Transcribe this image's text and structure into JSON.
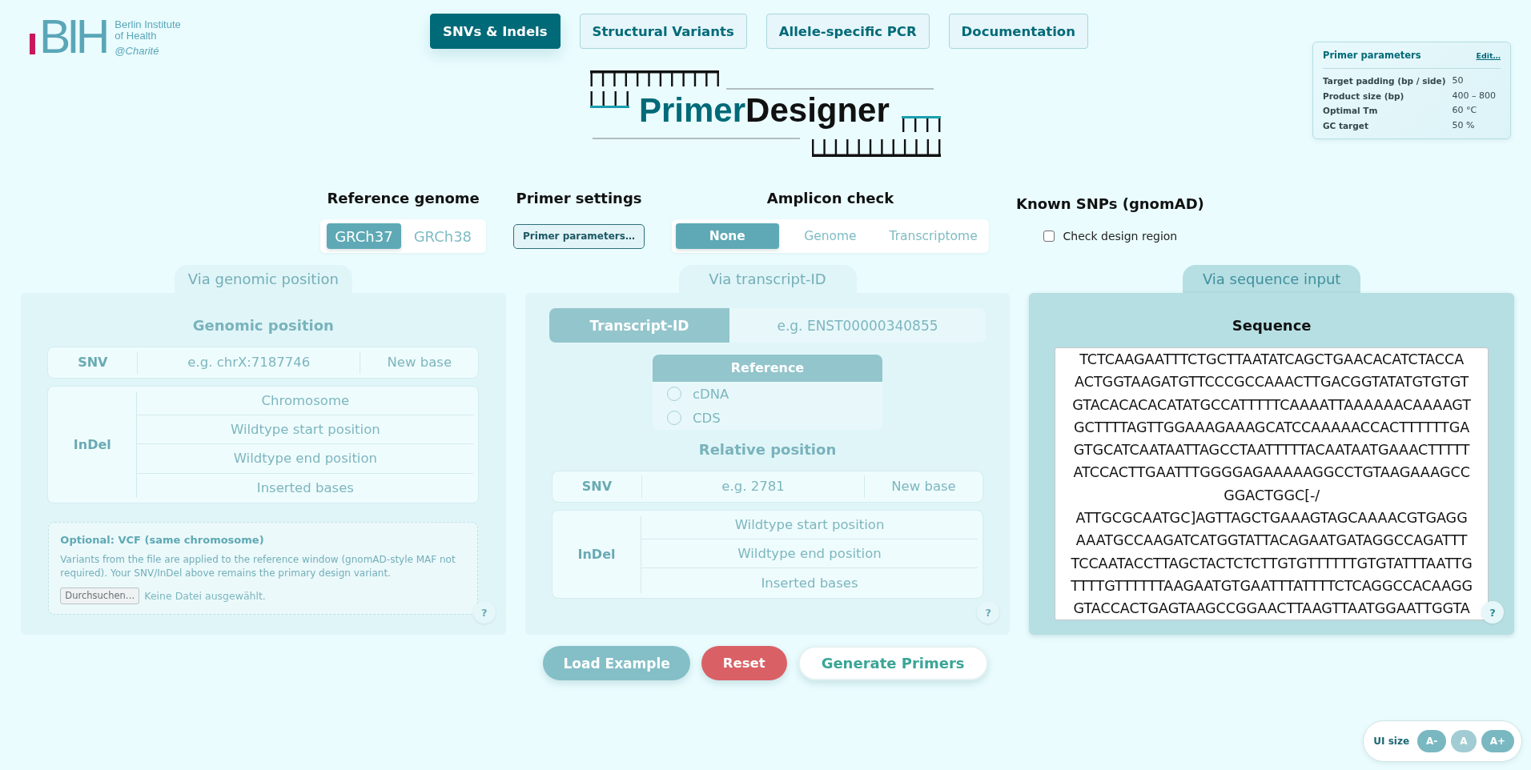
{
  "logo": {
    "mark": "BIH",
    "name_lines": [
      "Berlin Institute",
      "of Health"
    ],
    "affiliation": "@Charité"
  },
  "nav_tabs": [
    {
      "label": "SNVs & Indels",
      "selected": true
    },
    {
      "label": "Structural Variants",
      "selected": false
    },
    {
      "label": "Allele-specific PCR",
      "selected": false
    },
    {
      "label": "Documentation",
      "selected": false
    }
  ],
  "app_title": {
    "parts": [
      "Primer",
      "Designer"
    ]
  },
  "parameters_card": {
    "title": "Primer parameters",
    "edit_link": "Edit…",
    "rows": [
      {
        "label": "Target padding (bp / side)",
        "value": "50"
      },
      {
        "label": "Product size (bp)",
        "value": "400 – 800"
      },
      {
        "label": "Optimal Tm",
        "value": "60 °C"
      },
      {
        "label": "GC target",
        "value": "50 %"
      }
    ]
  },
  "settings": [
    {
      "kind": "toggle",
      "heading": "Reference genome",
      "options": [
        {
          "label": "GRCh37",
          "selected": true
        },
        {
          "label": "GRCh38",
          "selected": false
        }
      ]
    },
    {
      "kind": "button",
      "heading": "Primer settings",
      "button": "Primer parameters…"
    },
    {
      "kind": "segmented",
      "heading": "Amplicon check",
      "options": [
        {
          "label": "None",
          "selected": true
        },
        {
          "label": "Genome",
          "selected": false
        },
        {
          "label": "Transcriptome",
          "selected": false
        }
      ]
    },
    {
      "kind": "checkbox",
      "heading": "Known SNPs (gnomAD)",
      "label": "Check design region",
      "checked": false
    }
  ],
  "input_methods": [
    {
      "kind": "genomic",
      "tab": "Via genomic position",
      "selected": false,
      "heading": "Genomic position",
      "snv": {
        "label": "SNV",
        "fields": [
          {
            "placeholder": "e.g. chrX:7187746"
          },
          {
            "placeholder": "New base"
          }
        ]
      },
      "indel": {
        "label": "InDel",
        "fields": [
          {
            "placeholder": "Chromosome"
          },
          {
            "placeholder": "Wildtype start position"
          },
          {
            "placeholder": "Wildtype end position"
          },
          {
            "placeholder": "Inserted bases"
          }
        ]
      },
      "vcf": {
        "title": "Optional: VCF (same chromosome)",
        "description": "Variants from the file are applied to the reference window (gnomAD-style MAF not required). Your SNV/InDel above remains the primary design variant.",
        "file_button": "Durchsuchen…",
        "file_status": "Keine Datei ausgewählt."
      },
      "help": "?"
    },
    {
      "kind": "transcript",
      "tab": "Via transcript-ID",
      "selected": false,
      "transcript_id": {
        "label": "Transcript-ID",
        "placeholder": "e.g. ENST00000340855"
      },
      "reference": {
        "title": "Reference",
        "options": [
          {
            "label": "cDNA",
            "selected": false
          },
          {
            "label": "CDS",
            "selected": false
          }
        ]
      },
      "heading": "Relative position",
      "snv": {
        "label": "SNV",
        "fields": [
          {
            "placeholder": "e.g. 2781"
          },
          {
            "placeholder": "New base"
          }
        ]
      },
      "indel": {
        "label": "InDel",
        "fields": [
          {
            "placeholder": "Wildtype start position"
          },
          {
            "placeholder": "Wildtype end position"
          },
          {
            "placeholder": "Inserted bases"
          }
        ]
      },
      "help": "?"
    },
    {
      "kind": "sequence",
      "tab": "Via sequence input",
      "selected": true,
      "heading": "Sequence",
      "sequence": {
        "value_lines": [
          "TCTCAAGAATTTCTGCTTAATATCAGCTGAACACATCTACCA",
          "ACTGGTAAGATGTTCCCGCCAAACTTGACGGTATATGTGTGT",
          "GTACACACACATATGCCATTTTTCAAAATTAAAAAACAAAAGT",
          "GCTTTTAGTTGGAAAGAAAGCATCCAAAAACCACTTTTTTGA",
          "GTGCATCAATAATTAGCCTAATTTTTACAATAATGAAACTTTTT",
          "ATCCACTTGAATTTGGGGAGAAAAAGGCCTGTAAGAAAGCC",
          "GGACTGGC[-/",
          "ATTGCGCAATGC]AGTTAGCTGAAAGTAGCAAAACGTGAGG",
          "AAATGCCAAGATCATGGTATTACAGAATGATAGGCCAGATTT",
          "TCCAATACCTTAGCTACTCTCTTGTGTTTTTTGTGTATTTAATTG",
          "TTTTGTTTTTTAAGAATGTGAATTTATTTTCTCAGGCCACAAGG",
          "GTACCACTGAGTAAGCCGGAACTTAAGTTAATGGAATTGGTA"
        ]
      },
      "help": "?"
    }
  ],
  "actions": [
    {
      "label": "Load Example",
      "kind": "secondary"
    },
    {
      "label": "Reset",
      "kind": "danger"
    },
    {
      "label": "Generate Primers",
      "kind": "primary"
    }
  ],
  "ui_size": {
    "label": "UI size",
    "buttons": [
      {
        "label": "A-",
        "disabled": false
      },
      {
        "label": "A",
        "disabled": true
      },
      {
        "label": "A+",
        "disabled": false
      }
    ]
  }
}
